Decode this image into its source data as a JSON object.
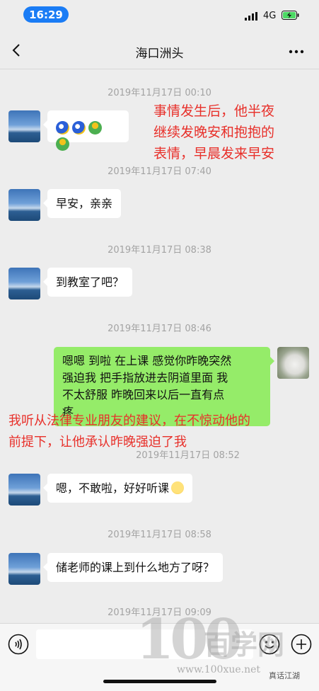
{
  "status_bar": {
    "time": "16:29",
    "network": "4G"
  },
  "nav": {
    "title": "海口洲头"
  },
  "messages": {
    "ts1": "2019年11月17日 00:10",
    "annot1_l1": "事情发生后，他半夜",
    "annot1_l2": "继续发晚安和抱抱的",
    "annot1_l3": "表情，早晨发来早安",
    "ts2": "2019年11月17日 07:40",
    "m2": "早安，亲亲",
    "ts3": "2019年11月17日 08:38",
    "m3": "到教室了吧？",
    "ts4": "2019年11月17日 08:46",
    "m4_l1": "嗯嗯 到啦 在上课 感觉你昨晚突然",
    "m4_l2": "强迫我 把手指放进去阴道里面 我",
    "m4_l3": "不太舒服 昨晚回来以后一直有点",
    "m4_l4": "疼",
    "annot2_l1": "我听从法律专业朋友的建议，在不惊动他的",
    "annot2_l2": "前提下，让他承认昨晚强迫了我",
    "ts5": "2019年11月17日 08:52",
    "m5": "嗯，不敢啦，好好听课",
    "ts6": "2019年11月17日 08:58",
    "m6": "储老师的课上到什么地方了呀？",
    "ts7": "2019年11月17日 09:09"
  },
  "watermark": {
    "digits": "100",
    "name": "百学网",
    "url": "www.100xue.net",
    "account": "真话江湖"
  },
  "colors": {
    "annotation": "#e8302a",
    "bubble_out": "#95ec69",
    "background": "#ededed",
    "time_pill": "#1a7cf5"
  }
}
